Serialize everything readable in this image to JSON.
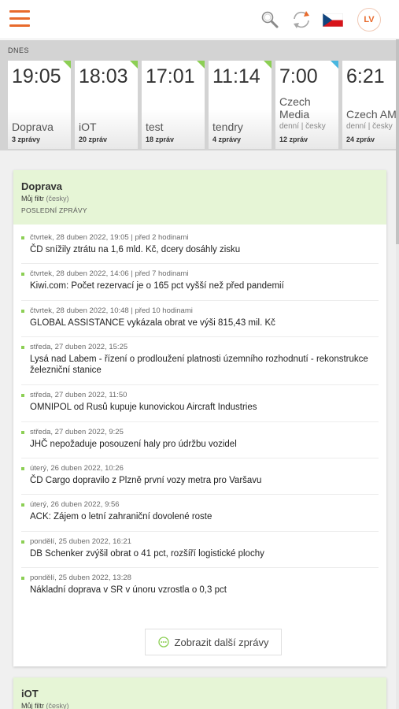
{
  "header": {
    "menu_icon": "hamburger-menu-icon",
    "search_icon": "search-icon",
    "refresh_icon": "refresh-icon",
    "language_flag": "czech-flag-icon",
    "user_initials": "LV",
    "accent_color": "#e86a2c"
  },
  "today": {
    "label": "DNES",
    "cards": [
      {
        "time": "19:05",
        "name": "Doprava",
        "sub": "",
        "count": "3 zprávy",
        "corner_color": "#8ccf54"
      },
      {
        "time": "18:03",
        "name": "iOT",
        "sub": "",
        "count": "20 zpráv",
        "corner_color": "#8ccf54"
      },
      {
        "time": "17:01",
        "name": "test",
        "sub": "",
        "count": "18 zpráv",
        "corner_color": "#8ccf54"
      },
      {
        "time": "11:14",
        "name": "tendry",
        "sub": "",
        "count": "4 zprávy",
        "corner_color": "#8ccf54"
      },
      {
        "time": "7:00",
        "name": "Czech Media",
        "sub": "denní | česky",
        "count": "12 zpráv",
        "corner_color": "#48b7e0"
      },
      {
        "time": "6:21",
        "name": "Czech AM",
        "sub": "denní | česky",
        "count": "24 zpráv",
        "corner_color": "#48b7e0"
      }
    ]
  },
  "panels": [
    {
      "title": "Doprava",
      "filter": "Můj filtr",
      "language": "(česky)",
      "section": "POSLEDNÍ ZPRÁVY",
      "header_color": "#e6f5d6",
      "items": [
        {
          "meta": "čtvrtek, 28 duben 2022, 19:05 | před 2 hodinami",
          "title": "ČD snížily ztrátu na 1,6 mld. Kč, dcery dosáhly zisku"
        },
        {
          "meta": "čtvrtek, 28 duben 2022, 14:06 | před 7 hodinami",
          "title": "Kiwi.com: Počet rezervací je o 165 pct vyšší než před pandemií"
        },
        {
          "meta": "čtvrtek, 28 duben 2022, 10:48 | před 10 hodinami",
          "title": "GLOBAL ASSISTANCE vykázala obrat ve výši 815,43 mil. Kč"
        },
        {
          "meta": "středa, 27 duben 2022, 15:25",
          "title": "Lysá nad Labem - řízení o prodloužení platnosti územního rozhodnutí - rekonstrukce železniční stanice"
        },
        {
          "meta": "středa, 27 duben 2022, 11:50",
          "title": "OMNIPOL od Rusů kupuje kunovickou Aircraft Industries"
        },
        {
          "meta": "středa, 27 duben 2022, 9:25",
          "title": "JHČ nepožaduje posouzení haly pro údržbu vozidel"
        },
        {
          "meta": "úterý, 26 duben 2022, 10:26",
          "title": "ČD Cargo dopravilo z Plzně první vozy metra pro Varšavu"
        },
        {
          "meta": "úterý, 26 duben 2022, 9:56",
          "title": "ACK: Zájem o letní zahraniční dovolené roste"
        },
        {
          "meta": "pondělí, 25 duben 2022, 16:21",
          "title": "DB Schenker zvýšil obrat o 41 pct, rozšíří logistické plochy"
        },
        {
          "meta": "pondělí, 25 duben 2022, 13:28",
          "title": "Nákladní doprava v SR v únoru vzrostla o 0,3 pct"
        }
      ],
      "more_label": "Zobrazit další zprávy"
    },
    {
      "title": "iOT",
      "filter": "Můj filtr",
      "language": "(česky)"
    }
  ]
}
